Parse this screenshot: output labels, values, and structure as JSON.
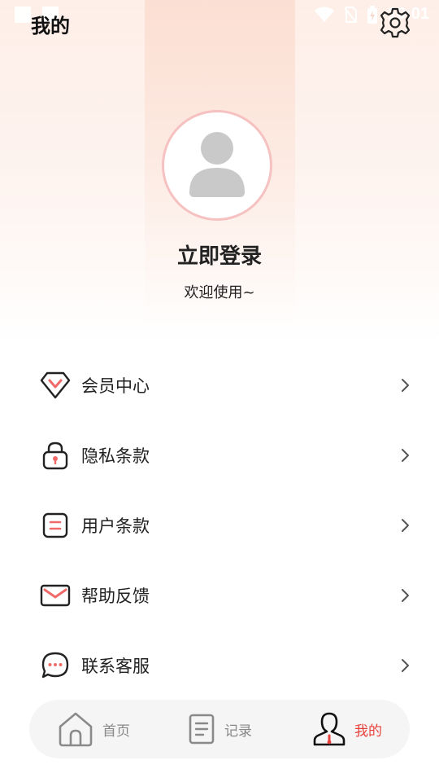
{
  "status_bar": {
    "time": "10:01"
  },
  "header": {
    "title": "我的"
  },
  "profile": {
    "login_label": "立即登录",
    "welcome_text": "欢迎使用~"
  },
  "menu": {
    "items": [
      {
        "label": "会员中心",
        "icon": "vip-diamond-icon"
      },
      {
        "label": "隐私条款",
        "icon": "lock-icon"
      },
      {
        "label": "用户条款",
        "icon": "document-icon"
      },
      {
        "label": "帮助反馈",
        "icon": "mail-icon"
      },
      {
        "label": "联系客服",
        "icon": "chat-bubble-icon"
      }
    ]
  },
  "bottom_nav": {
    "items": [
      {
        "label": "首页",
        "icon": "home-icon",
        "active": false
      },
      {
        "label": "记录",
        "icon": "record-icon",
        "active": false
      },
      {
        "label": "我的",
        "icon": "user-icon",
        "active": true
      }
    ]
  },
  "colors": {
    "accent": "#e8403b",
    "avatar_border": "#f6c1c1",
    "nav_bg": "#f5f5f5"
  }
}
